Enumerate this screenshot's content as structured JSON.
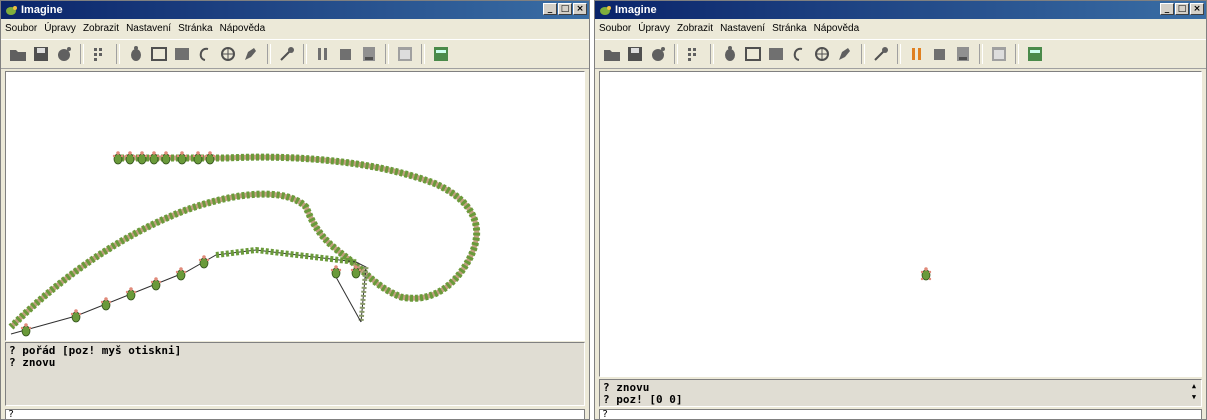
{
  "windows": [
    {
      "id": "left",
      "title": "Imagine",
      "menu": [
        "Soubor",
        "Úpravy",
        "Zobrazit",
        "Nastavení",
        "Stránka",
        "Nápověda"
      ],
      "history": [
        "? pořád [poz! myš otiskni]",
        "? znovu"
      ],
      "command_prompt": "?"
    },
    {
      "id": "right",
      "title": "Imagine",
      "menu": [
        "Soubor",
        "Úpravy",
        "Zobrazit",
        "Nastavení",
        "Stránka",
        "Nápověda"
      ],
      "history": [
        "? znovu",
        "? poz! [0 0]"
      ],
      "command_prompt": "?"
    }
  ],
  "window_buttons": {
    "minimize": "_",
    "maximize": "□",
    "close": "×"
  },
  "colors": {
    "titlebar_start": "#0a246a",
    "titlebar_end": "#3a6ea5",
    "window_bg": "#ece9d8",
    "turtle_green": "#6a9a3a",
    "turtle_shell": "#e08a7a"
  },
  "toolbar_icons": [
    "open-folder-icon",
    "save-icon",
    "turtle-shell-icon",
    "grid-icon",
    "turtle-icon",
    "rectangle-icon",
    "filled-rectangle-icon",
    "lasso-icon",
    "stamp-icon",
    "pen-icon",
    "magic-icon",
    "pause-icon",
    "stop-icon",
    "page-icon",
    "window-icon",
    "panel-icon"
  ]
}
